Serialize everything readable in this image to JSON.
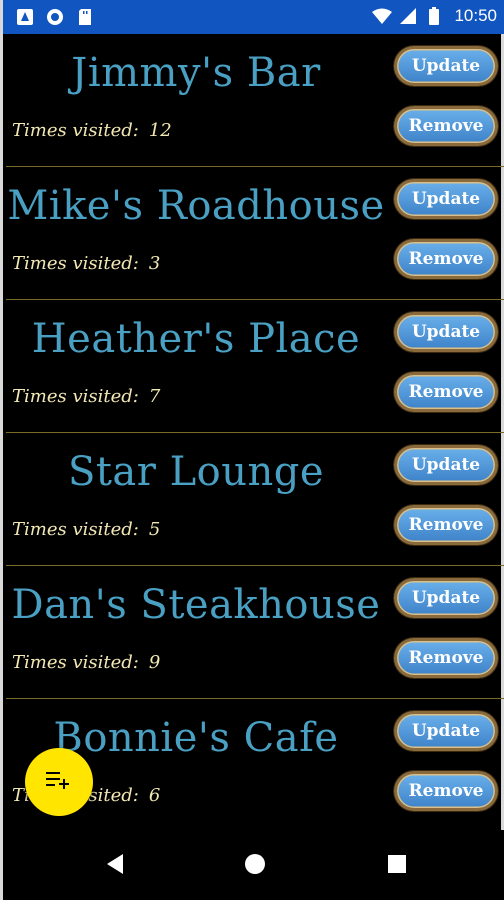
{
  "status_bar": {
    "time": "10:50",
    "icons": [
      "app-notification-icon",
      "sync-icon",
      "sd-card-icon",
      "wifi-icon",
      "signal-icon",
      "battery-icon"
    ],
    "background": "#1155c0"
  },
  "list": {
    "visits_label": "Times visited:",
    "update_label": "Update",
    "remove_label": "Remove",
    "items": [
      {
        "name": "Jimmy's Bar",
        "visits": "12"
      },
      {
        "name": "Mike's Roadhouse",
        "visits": "3"
      },
      {
        "name": "Heather's Place",
        "visits": "7"
      },
      {
        "name": "Star Lounge",
        "visits": "5"
      },
      {
        "name": "Dan's Steakhouse",
        "visits": "9"
      },
      {
        "name": "Bonnie's Cafe",
        "visits": "6"
      }
    ]
  },
  "fab": {
    "icon": "playlist-add-icon",
    "color": "#ffe500"
  },
  "nav_bar": {
    "icons": [
      "back-icon",
      "home-icon",
      "recents-icon"
    ]
  },
  "colors": {
    "title": "#4aa0c3",
    "visits_text": "#f2e8b3",
    "button": "#4f93d6",
    "divider": "#7a6a2a"
  }
}
